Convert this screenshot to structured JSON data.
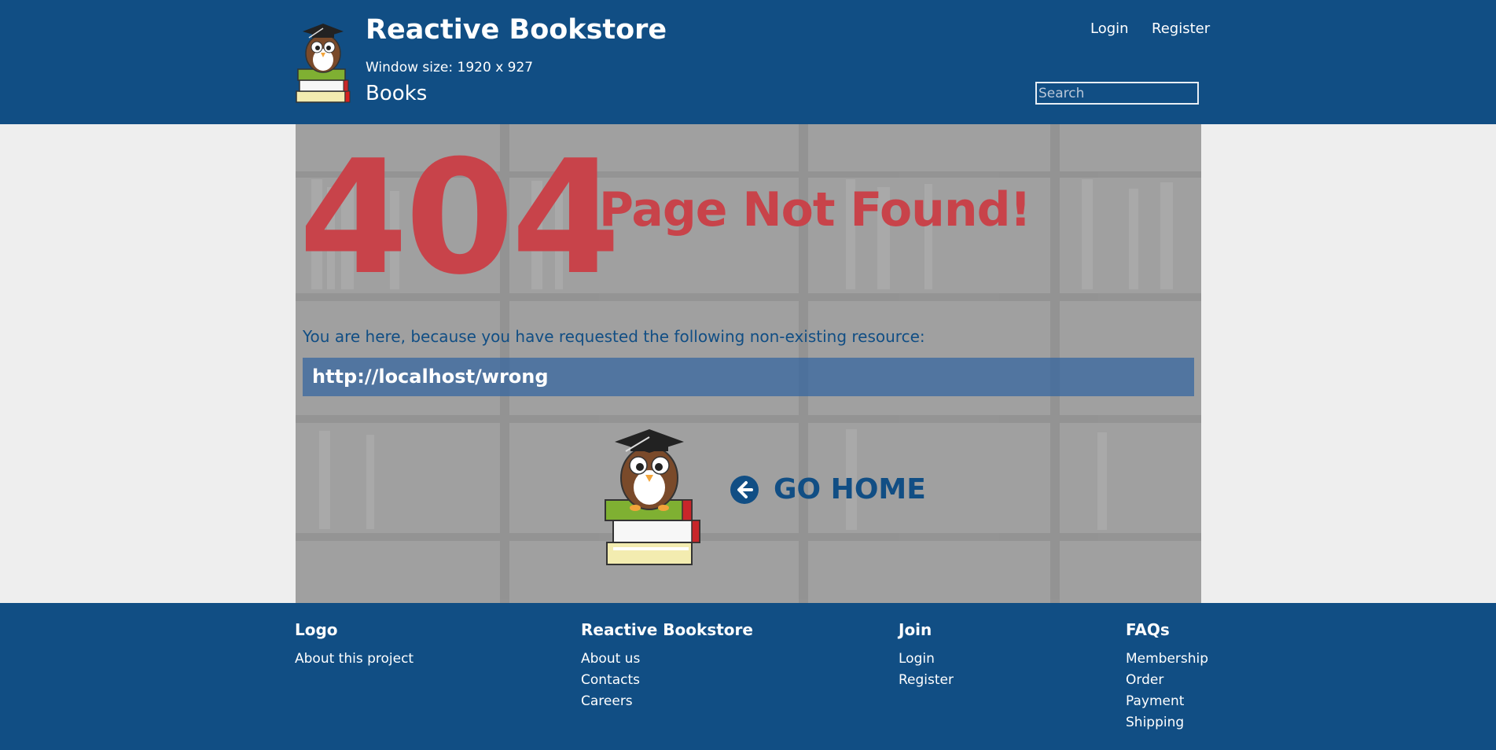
{
  "header": {
    "brand": "Reactive Bookstore",
    "window_size": "Window size: 1920 x 927",
    "section": "Books",
    "login": "Login",
    "register": "Register",
    "search_placeholder": "Search"
  },
  "error": {
    "code": "404",
    "title": "Page Not Found!",
    "explanation": "You are here, because you have requested the following non-existing resource:",
    "url": "http://localhost/wrong",
    "home_label": "GO HOME"
  },
  "footer": {
    "columns": [
      {
        "title": "Logo",
        "links": [
          "About this project"
        ]
      },
      {
        "title": "Reactive Bookstore",
        "links": [
          "About us",
          "Contacts",
          "Careers"
        ]
      },
      {
        "title": "Join",
        "links": [
          "Login",
          "Register"
        ]
      },
      {
        "title": "FAQs",
        "links": [
          "Membership",
          "Order",
          "Payment",
          "Shipping"
        ]
      }
    ]
  },
  "colors": {
    "primary": "#114e84",
    "error_red": "#c8434a",
    "page_bg": "#eeeeee"
  },
  "icons": [
    "owl-logo-icon",
    "owl-illustration-icon",
    "arrow-left-circle-icon"
  ]
}
